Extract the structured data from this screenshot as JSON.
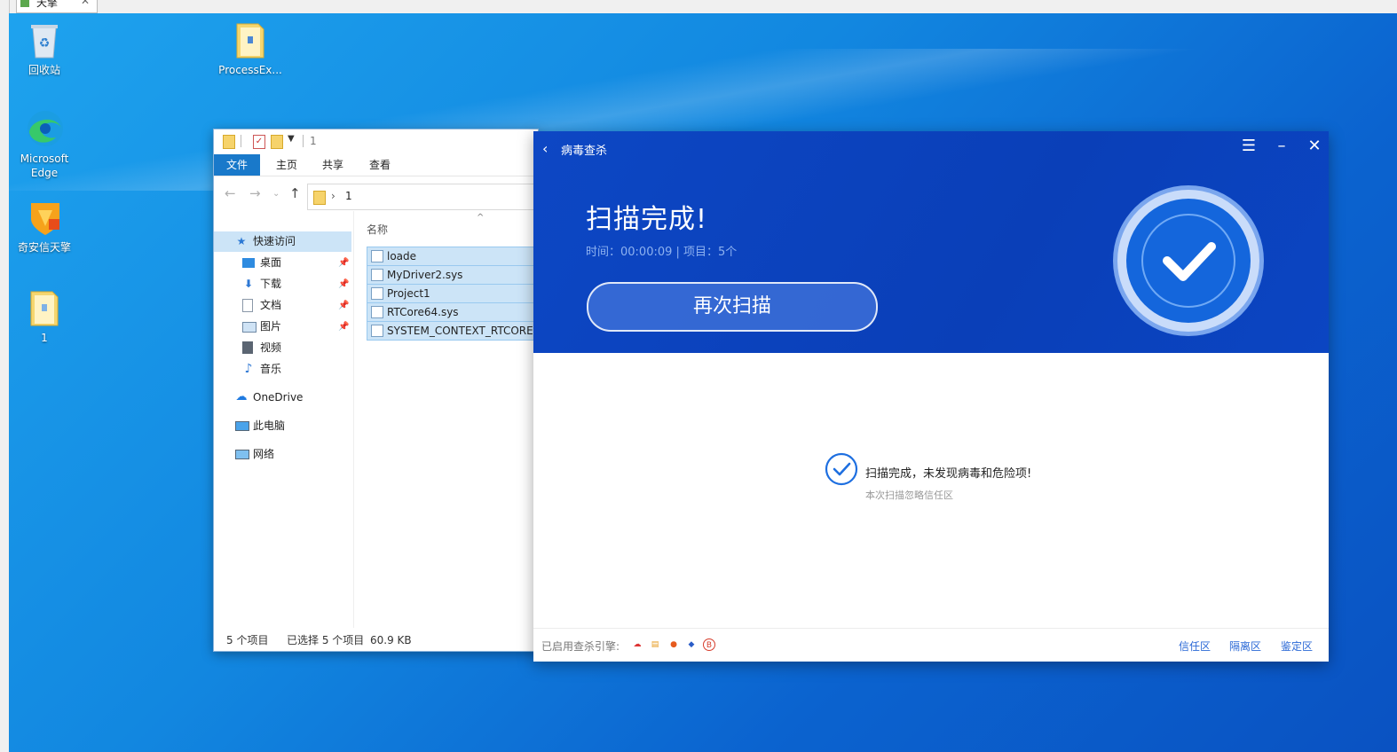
{
  "taskbar_tab": {
    "label": "天擎"
  },
  "desktop_icons": [
    {
      "label": "回收站"
    },
    {
      "label": "ProcessEx..."
    },
    {
      "label": "Microsoft Edge"
    },
    {
      "label": "奇安信天擎"
    },
    {
      "label": "1"
    }
  ],
  "explorer": {
    "title": "1",
    "ribbon_tabs": [
      "文件",
      "主页",
      "共享",
      "查看"
    ],
    "address": "1",
    "nav_items": [
      {
        "label": "快速访问",
        "icon": "star-icon",
        "pinned": false
      },
      {
        "label": "桌面",
        "icon": "desktop-icon",
        "pinned": true
      },
      {
        "label": "下载",
        "icon": "download-icon",
        "pinned": true
      },
      {
        "label": "文档",
        "icon": "document-icon",
        "pinned": true
      },
      {
        "label": "图片",
        "icon": "picture-icon",
        "pinned": true
      },
      {
        "label": "视频",
        "icon": "video-icon",
        "pinned": false
      },
      {
        "label": "音乐",
        "icon": "music-icon",
        "pinned": false
      },
      {
        "label": "OneDrive",
        "icon": "cloud-icon",
        "pinned": false
      },
      {
        "label": "此电脑",
        "icon": "computer-icon",
        "pinned": false
      },
      {
        "label": "网络",
        "icon": "network-icon",
        "pinned": false
      }
    ],
    "column_header": "名称",
    "files": [
      {
        "name": "loade"
      },
      {
        "name": "MyDriver2.sys"
      },
      {
        "name": "Project1"
      },
      {
        "name": "RTCore64.sys"
      },
      {
        "name": "SYSTEM_CONTEXT_RTCORE"
      }
    ],
    "status_count": "5 个项目",
    "status_selected": "已选择 5 个项目",
    "status_size": "60.9 KB"
  },
  "antivirus": {
    "title": "病毒查杀",
    "headline": "扫描完成!",
    "meta": "时间：00:00:09 | 项目：5个",
    "rescan_label": "再次扫描",
    "result_text": "扫描完成，未发现病毒和危险项!",
    "result_sub": "本次扫描忽略信任区",
    "engines_label": "已启用查杀引擎:",
    "engine_b_label": "B",
    "links": {
      "trust": "信任区",
      "quarantine": "隔离区",
      "identify": "鉴定区"
    },
    "colors": {
      "header": "#0a3fb8",
      "accent": "#2a68d6"
    }
  }
}
